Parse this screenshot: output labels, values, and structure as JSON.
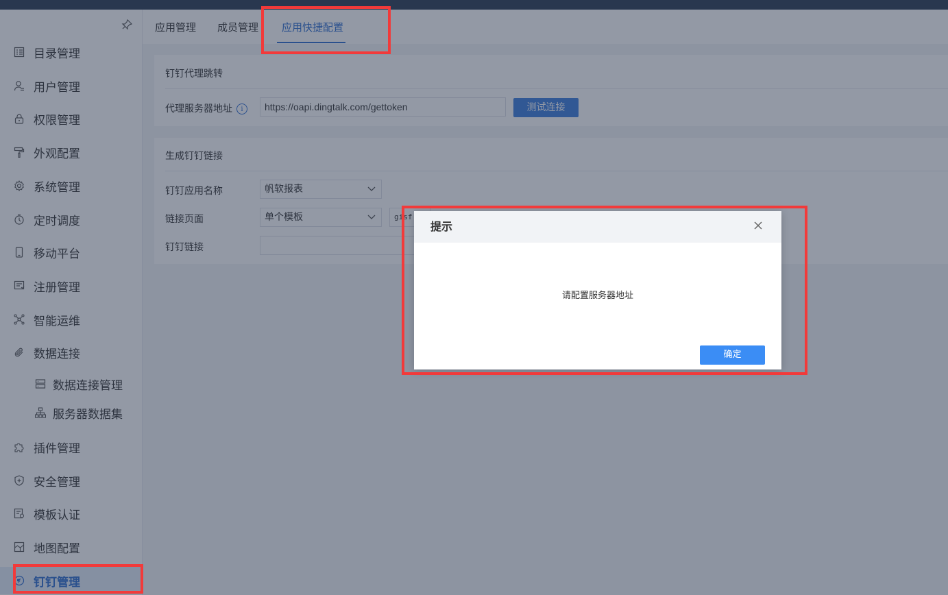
{
  "sidebar": {
    "items": [
      {
        "label": "目录管理",
        "icon": "list-icon"
      },
      {
        "label": "用户管理",
        "icon": "user-icon"
      },
      {
        "label": "权限管理",
        "icon": "lock-icon"
      },
      {
        "label": "外观配置",
        "icon": "paint-roller-icon"
      },
      {
        "label": "系统管理",
        "icon": "gear-icon"
      },
      {
        "label": "定时调度",
        "icon": "timer-icon"
      },
      {
        "label": "移动平台",
        "icon": "mobile-icon"
      },
      {
        "label": "注册管理",
        "icon": "register-icon"
      },
      {
        "label": "智能运维",
        "icon": "network-icon"
      },
      {
        "label": "数据连接",
        "icon": "paperclip-icon"
      },
      {
        "label": "数据连接管理",
        "icon": "database-icon"
      },
      {
        "label": "服务器数据集",
        "icon": "hierarchy-icon"
      },
      {
        "label": "插件管理",
        "icon": "puzzle-icon"
      },
      {
        "label": "安全管理",
        "icon": "shield-icon"
      },
      {
        "label": "模板认证",
        "icon": "certificate-icon"
      },
      {
        "label": "地图配置",
        "icon": "map-icon"
      },
      {
        "label": "钉钉管理",
        "icon": "dingtalk-icon"
      }
    ]
  },
  "tabs": [
    {
      "label": "应用管理"
    },
    {
      "label": "成员管理"
    },
    {
      "label": "应用快捷配置"
    }
  ],
  "proxy": {
    "title": "钉钉代理跳转",
    "address_label": "代理服务器地址",
    "address_value": "https://oapi.dingtalk.com/gettoken",
    "test_button": "测试连接"
  },
  "link": {
    "title": "生成钉钉链接",
    "app_name_label": "钉钉应用名称",
    "app_name_value": "帆软报表",
    "page_label": "链接页面",
    "page_value": "单个模板",
    "page_extra": "gisf",
    "link_label": "钉钉链接",
    "link_value": ""
  },
  "dialog": {
    "title": "提示",
    "message": "请配置服务器地址",
    "ok": "确定"
  },
  "colors": {
    "accent": "#2d6ccf",
    "highlight": "#f23a3a",
    "topbar": "#2b3a52"
  }
}
